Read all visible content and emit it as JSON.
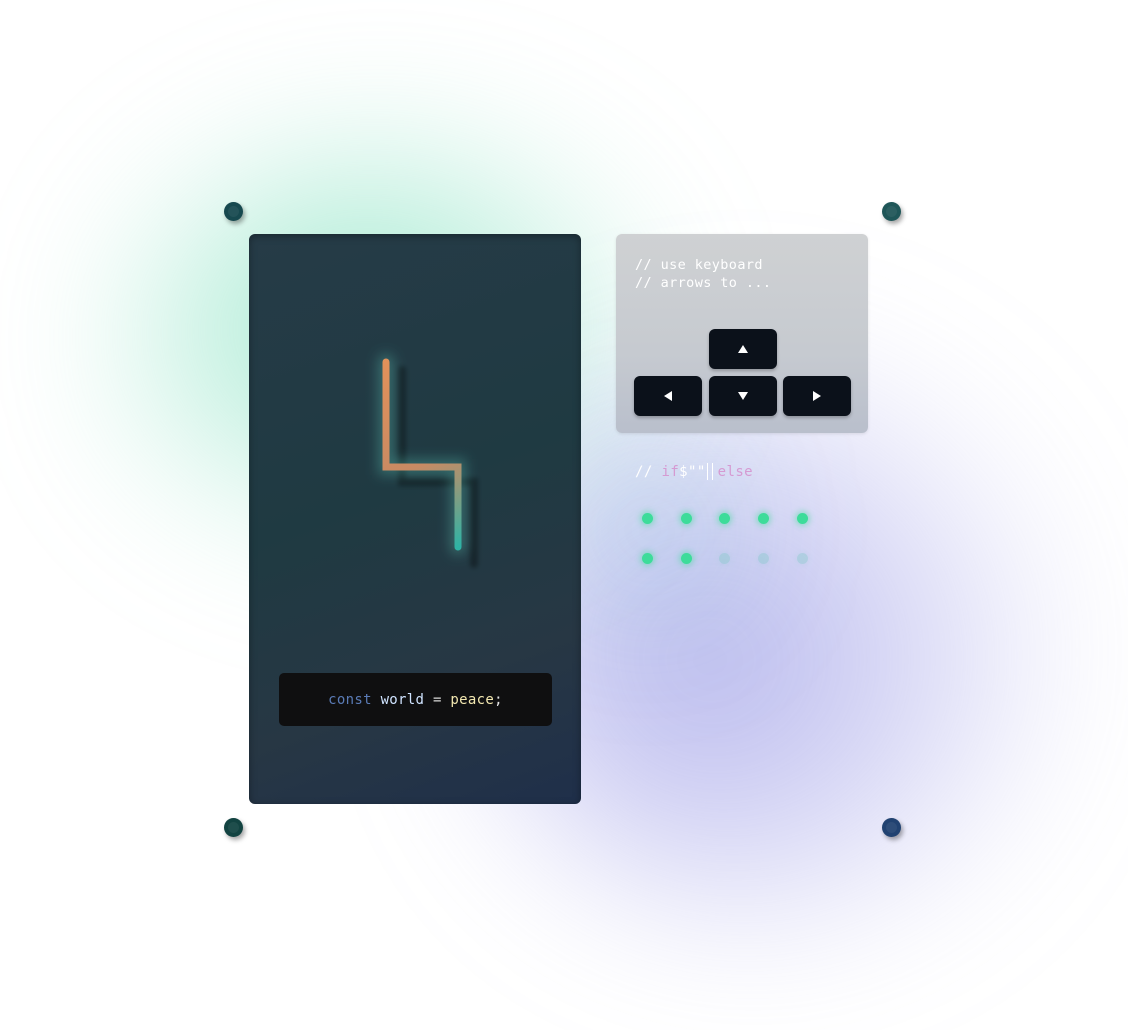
{
  "theme": {
    "accent_green": "#3ddc9a",
    "snake_head_color": "#e1915a",
    "snake_tail_color": "#2fb3a5",
    "screw_colors": [
      "#17494f",
      "#1f5658",
      "#124341",
      "#214271"
    ]
  },
  "game": {
    "code_line": {
      "keyword": "const",
      "variable": "world",
      "operator": "=",
      "value": "peace",
      "terminator": ";"
    }
  },
  "controls": {
    "hint_line_1": "// use keyboard",
    "hint_line_2": "// arrows to ...",
    "keys": [
      {
        "name": "up",
        "icon": "triangle-up-icon"
      },
      {
        "name": "left",
        "icon": "triangle-left-icon"
      },
      {
        "name": "down",
        "icon": "triangle-down-icon"
      },
      {
        "name": "right",
        "icon": "triangle-right-icon"
      }
    ]
  },
  "status": {
    "comment": "// ",
    "if_text": "if",
    "string_text": "$\"\"",
    "else_text": "else"
  },
  "food": {
    "total": 10,
    "remaining": 7
  }
}
